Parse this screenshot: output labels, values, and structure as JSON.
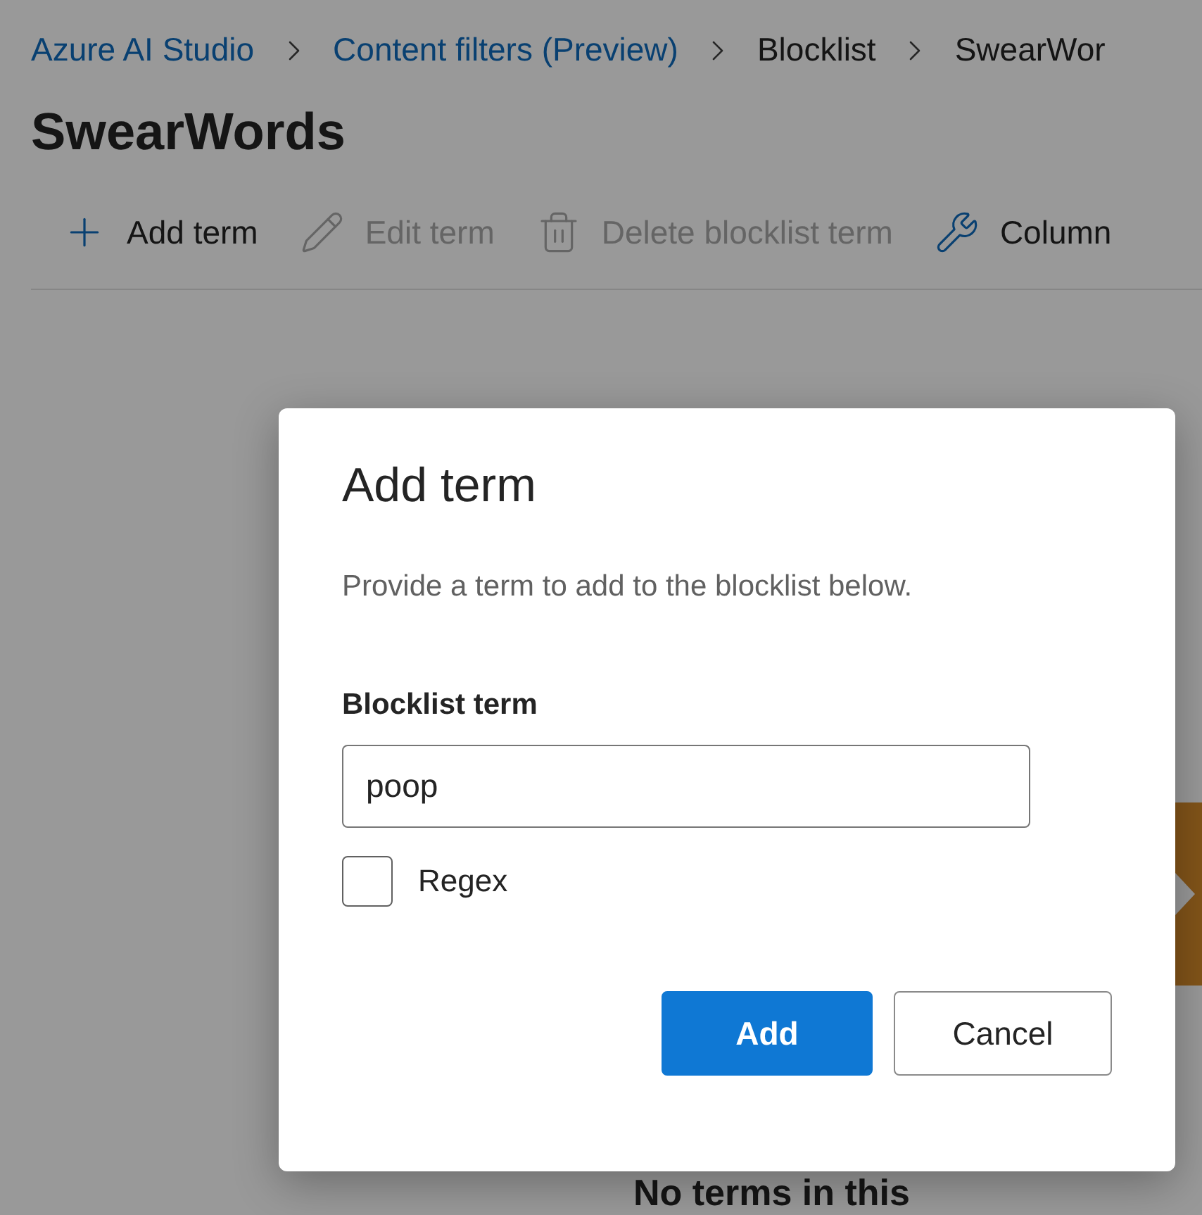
{
  "breadcrumb": [
    {
      "label": "Azure AI Studio",
      "kind": "link"
    },
    {
      "label": "Content filters (Preview)",
      "kind": "link"
    },
    {
      "label": "Blocklist",
      "kind": "current"
    },
    {
      "label": "SwearWor",
      "kind": "current"
    }
  ],
  "title": "SwearWords",
  "toolbar": [
    {
      "label": "Add term",
      "kind": "add",
      "disabled": false
    },
    {
      "label": "Edit term",
      "kind": "edit",
      "disabled": true
    },
    {
      "label": "Delete blocklist term",
      "kind": "delete",
      "disabled": true
    },
    {
      "label": "Column",
      "kind": "columns",
      "disabled": false
    }
  ],
  "empty_state": {
    "message": "No terms in this"
  },
  "dialog": {
    "title": "Add term",
    "description": "Provide a term to add to the blocklist below.",
    "field": {
      "label": "Blocklist term",
      "value": "poop"
    },
    "checkbox": {
      "label": "Regex",
      "checked": false
    },
    "buttons": [
      {
        "label": "Add",
        "kind": "primary"
      },
      {
        "label": "Cancel",
        "kind": "secondary"
      }
    ]
  }
}
